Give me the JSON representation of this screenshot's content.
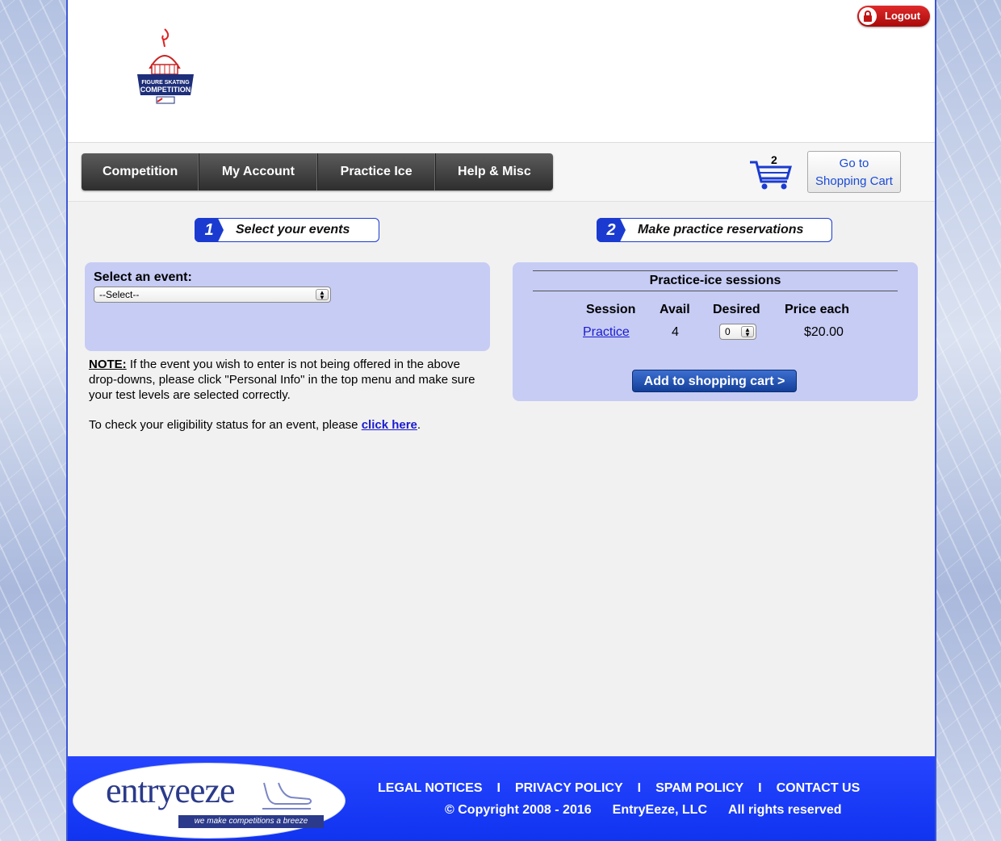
{
  "header": {
    "logout_label": "Logout",
    "logo_text": "FIGURE SKATING COMPETITION"
  },
  "nav": {
    "items": [
      "Competition",
      "My Account",
      "Practice Ice",
      "Help & Misc"
    ]
  },
  "cart": {
    "count": "2",
    "button_line1": "Go to",
    "button_line2": "Shopping Cart"
  },
  "steps": [
    {
      "number": "1",
      "label": "Select your events"
    },
    {
      "number": "2",
      "label": "Make practice reservations"
    }
  ],
  "event_select": {
    "label": "Select an event:",
    "selected": "--Select--"
  },
  "note": {
    "heading": "NOTE:",
    "text": " If the event you wish to enter is not being offered in the above drop-downs, please click \"Personal Info\" in the top menu and make sure your test levels are selected correctly.",
    "eligibility_prefix": "To check your eligibility status for an event, please ",
    "eligibility_link": "click here",
    "eligibility_suffix": "."
  },
  "practice_ice": {
    "title": "Practice-ice sessions",
    "columns": [
      "Session",
      "Avail",
      "Desired",
      "Price each"
    ],
    "rows": [
      {
        "session": "Practice",
        "avail": "4",
        "desired": "0",
        "price": "$20.00"
      }
    ],
    "add_button": "Add to shopping cart  >"
  },
  "footer": {
    "brand": "entryeeze",
    "tagline": "we make competitions a breeze",
    "links": [
      "LEGAL NOTICES",
      "PRIVACY POLICY",
      "SPAM POLICY",
      "CONTACT US"
    ],
    "separator": "I",
    "copyright": "© Copyright 2008 - 2016",
    "company": "EntryEeze, LLC",
    "rights": "All rights reserved"
  },
  "colors": {
    "accent_blue": "#1b3bd0",
    "panel_bg": "#c6ccf4",
    "footer_bg": "#1034f0",
    "logout_red": "#c01515"
  }
}
